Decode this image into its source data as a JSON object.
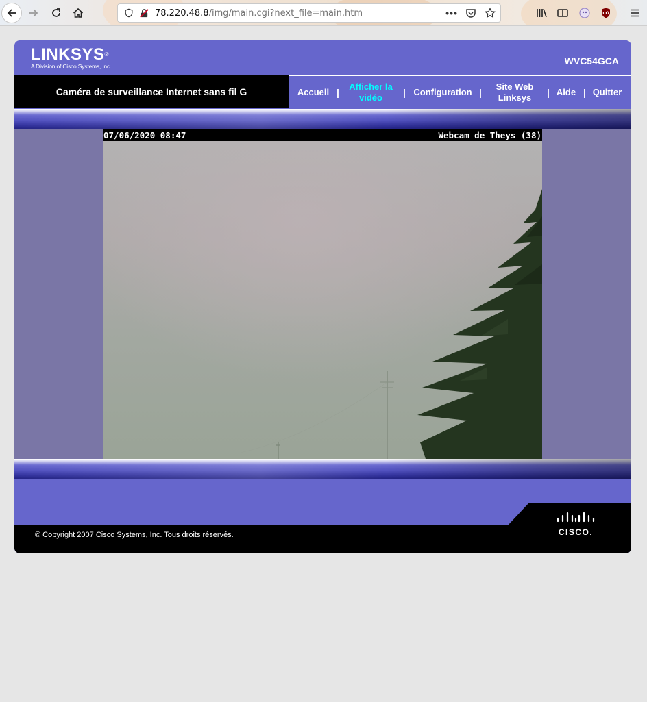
{
  "browser": {
    "url_host": "78.220.48.8",
    "url_path": "/img/main.cgi?next_file=main.htm",
    "icons": [
      "back-icon",
      "forward-icon",
      "reload-icon",
      "home-icon",
      "shield-icon",
      "insecure-lock-icon",
      "more-icon",
      "pocket-icon",
      "bookmark-star-icon",
      "library-icon",
      "reader-icon",
      "extension-icon",
      "ublock-icon",
      "menu-icon"
    ]
  },
  "header": {
    "logo_main": "LINKSYS",
    "logo_reg": "®",
    "logo_sub": "A Division of Cisco Systems, Inc.",
    "model": "WVC54GCA"
  },
  "nav": {
    "product_title": "Caméra de surveillance Internet sans fil G",
    "items": [
      {
        "label": "Accueil",
        "active": false
      },
      {
        "label": "Afficher la vidéo",
        "active": true
      },
      {
        "label": "Configuration",
        "active": false
      },
      {
        "label": "Site Web Linksys",
        "active": false
      },
      {
        "label": "Aide",
        "active": false
      },
      {
        "label": "Quitter",
        "active": false
      }
    ],
    "separator": "|"
  },
  "video": {
    "timestamp": "07/06/2020 08:47",
    "caption": "Webcam de Theys (38)"
  },
  "footer": {
    "copyright": "© Copyright 2007 Cisco Systems, Inc. Tous droits réservés.",
    "cisco_word": "CISCO."
  },
  "colors": {
    "brand_purple": "#6666cc",
    "active_link": "#00ffff",
    "video_frame": "#7a76a6"
  }
}
